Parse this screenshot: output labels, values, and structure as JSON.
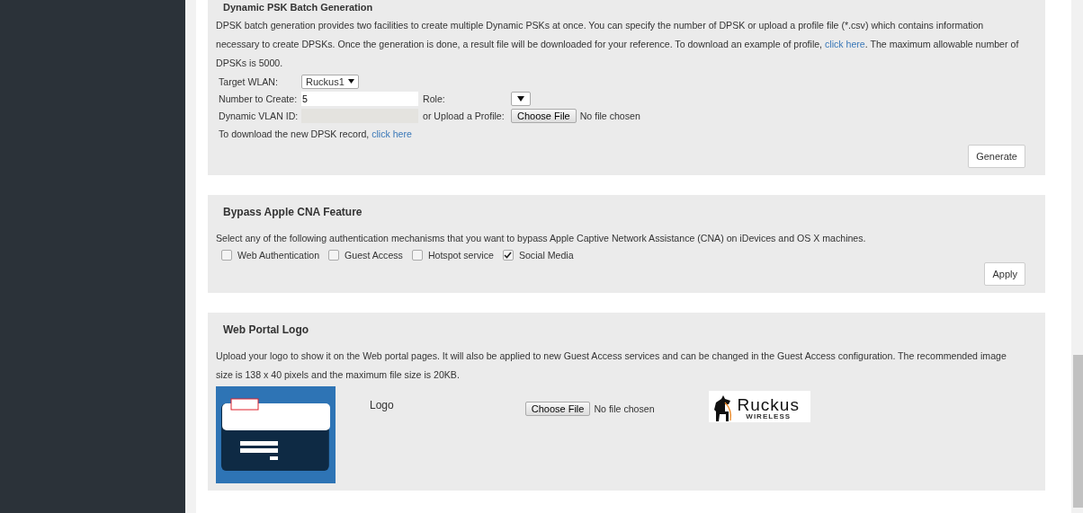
{
  "dpsk_batch": {
    "title": "Dynamic PSK Batch Generation",
    "description": {
      "before": "DPSK batch generation provides two facilities to create multiple Dynamic PSKs at once. You can specify the number of DPSK or upload a profile file (*.csv) which contains information necessary to create DPSKs. Once the generation is done, a result file will be downloaded for your reference. To download an example of profile, ",
      "link": "click here",
      "after": ". The maximum allowable number of DPSKs is 5000."
    },
    "target_wlan": {
      "label": "Target WLAN:",
      "value": "Ruckus1"
    },
    "number_to_create": {
      "label": "Number to Create:",
      "value": "5"
    },
    "role": {
      "label": "Role:"
    },
    "dynamic_vlan_id": {
      "label": "Dynamic VLAN ID:",
      "disabled": true
    },
    "upload_profile": {
      "label": "or Upload a Profile:",
      "button": "Choose File",
      "status": "No file chosen"
    },
    "download_record": {
      "before": "To download the new DPSK record, ",
      "link": "click here"
    },
    "button": "Generate"
  },
  "bypass_cna": {
    "title": "Bypass Apple CNA Feature",
    "description": "Select any of the following authentication mechanisms that you want to bypass Apple Captive Network Assistance (CNA) on iDevices and OS X machines.",
    "options": [
      {
        "label": "Web Authentication",
        "checked": false
      },
      {
        "label": "Guest Access",
        "checked": false
      },
      {
        "label": "Hotspot service",
        "checked": false
      },
      {
        "label": "Social Media",
        "checked": true
      }
    ],
    "button": "Apply"
  },
  "web_portal_logo": {
    "title": "Web Portal Logo",
    "description": "Upload your logo to show it on the Web portal pages. It will also be applied to new Guest Access services and can be changed in the Guest Access configuration. The recommended image size is 138 x 40 pixels and the maximum file size is 20KB.",
    "logo_label": "Logo",
    "button": "Choose File",
    "status": "No file chosen",
    "current_logo": {
      "name": "Ruckus",
      "tagline": "WIRELESS"
    }
  }
}
